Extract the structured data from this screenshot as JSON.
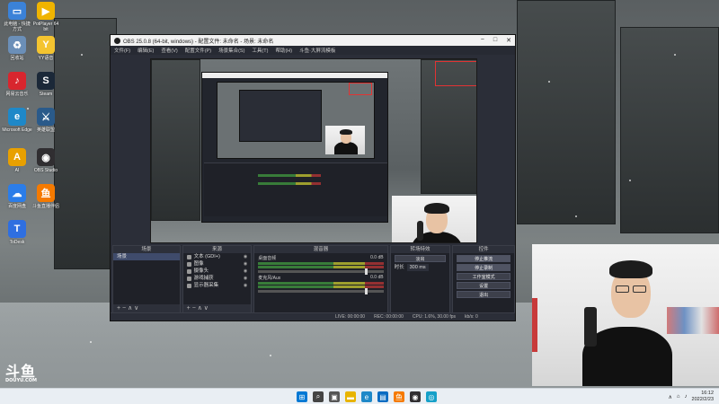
{
  "desktop": {
    "icons": [
      {
        "label": "此电脑 - 快捷方式",
        "color": "#3b82d8",
        "glyph": "▭",
        "icon": "computer-icon"
      },
      {
        "label": "PotPlayer 64 bit",
        "color": "#f0b400",
        "glyph": "▶",
        "icon": "potplayer-icon"
      },
      {
        "label": "回收站",
        "color": "#6b8fb8",
        "glyph": "♻",
        "icon": "recycle-bin-icon"
      },
      {
        "label": "YY语音",
        "color": "#f4c430",
        "glyph": "Y",
        "icon": "yy-icon"
      },
      {
        "label": "网易云音乐",
        "color": "#d8262e",
        "glyph": "♪",
        "icon": "netease-music-icon"
      },
      {
        "label": "Steam",
        "color": "#1b2838",
        "glyph": "S",
        "icon": "steam-icon"
      },
      {
        "label": "Microsoft Edge",
        "color": "#1e88c8",
        "glyph": "e",
        "icon": "edge-icon"
      },
      {
        "label": "英雄联盟",
        "color": "#2a5a8a",
        "glyph": "⚔",
        "icon": "lol-icon"
      },
      {
        "label": "AI",
        "color": "#e8a000",
        "glyph": "A",
        "icon": "app-icon"
      },
      {
        "label": "OBS Studio",
        "color": "#302e31",
        "glyph": "◉",
        "icon": "obs-icon"
      },
      {
        "label": "百度网盘",
        "color": "#2b7de9",
        "glyph": "☁",
        "icon": "baidu-netdisk-icon"
      },
      {
        "label": "斗鱼直播伴侣",
        "color": "#f57a00",
        "glyph": "鱼",
        "icon": "douyu-icon"
      },
      {
        "label": "ToDesk",
        "color": "#2f6fe0",
        "glyph": "T",
        "icon": "todesk-icon"
      }
    ]
  },
  "watermark": {
    "main": "斗鱼",
    "sub": "DOUYU.COM"
  },
  "obs": {
    "title": "OBS 25.0.8 (64-bit, windows) - 配置文件: 未命名 - 场景: 未命名",
    "menu": [
      "文件(F)",
      "编辑(E)",
      "查看(V)",
      "配置文件(P)",
      "场景集合(S)",
      "工具(T)",
      "帮助(H)",
      "斗鱼·大屏流模板"
    ],
    "panels": {
      "scenes": {
        "title": "场景",
        "items": [
          "场景"
        ]
      },
      "sources": {
        "title": "来源",
        "items": [
          "文本 (GDI+)",
          "图像",
          "摄像头",
          "游戏捕获",
          "显示器采集"
        ]
      },
      "mixer": {
        "title": "混音器",
        "tracks": [
          {
            "name": "桌面音频",
            "db": "0.0 dB"
          },
          {
            "name": "麦克风/Aux",
            "db": "0.0 dB"
          }
        ]
      },
      "transitions": {
        "title": "转场特效",
        "type": "淡出",
        "duration_label": "时长",
        "duration": "300 ms"
      },
      "controls": {
        "title": "控件",
        "buttons": [
          "停止推流",
          "停止录制",
          "工作室模式",
          "设置",
          "退出"
        ]
      }
    },
    "status": {
      "live": "LIVE: 00:00:00",
      "rec": "REC: 00:00:00",
      "cpu": "CPU: 1.6%, 30.00 fps",
      "kbps": "kb/s: 0"
    },
    "panel_footer": "+ − ∧ ∨"
  },
  "taskbar": {
    "apps": [
      {
        "name": "start-icon",
        "color": "#0078d4",
        "glyph": "⊞"
      },
      {
        "name": "search-icon",
        "color": "#444",
        "glyph": "⌕"
      },
      {
        "name": "task-view-icon",
        "color": "#555",
        "glyph": "▣"
      },
      {
        "name": "file-explorer-icon",
        "color": "#e8b400",
        "glyph": "▬"
      },
      {
        "name": "edge-icon",
        "color": "#1e88c8",
        "glyph": "e"
      },
      {
        "name": "store-icon",
        "color": "#0a6cc2",
        "glyph": "▤"
      },
      {
        "name": "douyu-icon",
        "color": "#f57a00",
        "glyph": "鱼"
      },
      {
        "name": "obs-icon",
        "color": "#302e31",
        "glyph": "◉"
      },
      {
        "name": "app-icon",
        "color": "#16a0c8",
        "glyph": "◎"
      }
    ],
    "time": "16:12",
    "date": "2022/2/23"
  }
}
